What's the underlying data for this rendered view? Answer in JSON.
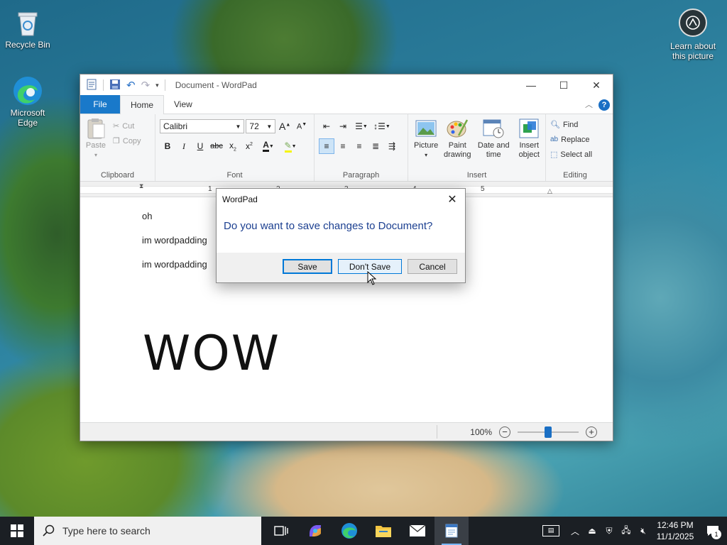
{
  "desktop": {
    "recycle_bin": "Recycle Bin",
    "edge": "Microsoft Edge",
    "learn": "Learn about this picture"
  },
  "window": {
    "title": "Document - WordPad"
  },
  "tabs": {
    "file": "File",
    "home": "Home",
    "view": "View"
  },
  "ribbon": {
    "clipboard": {
      "label": "Clipboard",
      "paste": "Paste",
      "cut": "Cut",
      "copy": "Copy"
    },
    "font": {
      "label": "Font",
      "family": "Calibri",
      "size": "72"
    },
    "paragraph": {
      "label": "Paragraph"
    },
    "insert": {
      "label": "Insert",
      "picture": "Picture",
      "paint": "Paint drawing",
      "datetime": "Date and time",
      "object": "Insert object"
    },
    "editing": {
      "label": "Editing",
      "find": "Find",
      "replace": "Replace",
      "select_all": "Select all"
    }
  },
  "ruler": {
    "marks": [
      "1",
      "2",
      "3",
      "4",
      "5"
    ]
  },
  "document": {
    "lines": [
      "oh",
      "im wordpadding",
      "im wordpadding"
    ],
    "big_text": "WOW"
  },
  "status": {
    "zoom": "100%",
    "zoom_level": 0.5
  },
  "dialog": {
    "title": "WordPad",
    "message": "Do you want to save changes to Document?",
    "save": "Save",
    "dont_save": "Don't Save",
    "cancel": "Cancel"
  },
  "taskbar": {
    "search_placeholder": "Type here to search",
    "time": "12:46 PM",
    "date": "11/1/2025",
    "notification_count": "1"
  },
  "colors": {
    "accent": "#1979ca",
    "dialog_text": "#1b3f90",
    "taskbar": "#1b1f24"
  }
}
